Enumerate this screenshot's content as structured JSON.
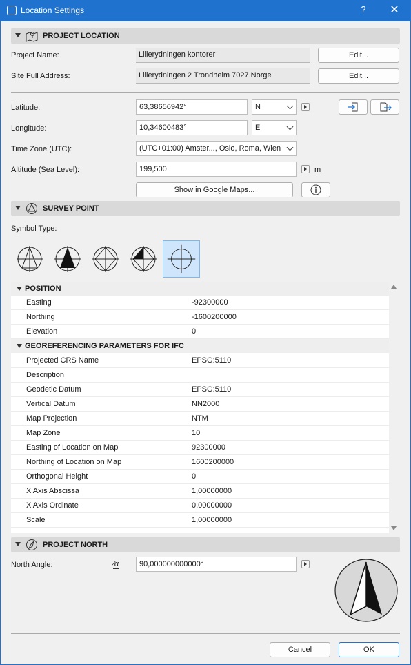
{
  "window": {
    "title": "Location Settings",
    "help": "?",
    "close": "✕"
  },
  "project_location": {
    "header": "PROJECT LOCATION",
    "project_name_label": "Project Name:",
    "project_name": "Lillerydningen kontorer",
    "site_address_label": "Site Full Address:",
    "site_address": "Lillerydningen 2 Trondheim 7027 Norge",
    "edit_label": "Edit...",
    "latitude_label": "Latitude:",
    "latitude": "63,38656942°",
    "lat_dir": "N",
    "longitude_label": "Longitude:",
    "longitude": "10,34600483°",
    "lon_dir": "E",
    "timezone_label": "Time Zone (UTC):",
    "timezone": "(UTC+01:00) Amster..., Oslo, Roma, Wien",
    "altitude_label": "Altitude (Sea Level):",
    "altitude": "199,500",
    "altitude_unit": "m",
    "google_maps_label": "Show in Google Maps..."
  },
  "survey_point": {
    "header": "SURVEY POINT",
    "symbol_type_label": "Symbol Type:",
    "symbols": [
      "symbol-outline-triangle",
      "symbol-filled-triangle",
      "symbol-quadrant-outline",
      "symbol-quadrant-filled",
      "symbol-crosshair"
    ],
    "selected_symbol": 4,
    "position_group": "POSITION",
    "position_rows": [
      {
        "k": "Easting",
        "v": "-92300000"
      },
      {
        "k": "Northing",
        "v": "-1600200000"
      },
      {
        "k": "Elevation",
        "v": "0"
      }
    ],
    "ifc_group": "GEOREFERENCING PARAMETERS FOR IFC",
    "ifc_rows": [
      {
        "k": "Projected CRS Name",
        "v": "EPSG:5110"
      },
      {
        "k": "Description",
        "v": ""
      },
      {
        "k": "Geodetic Datum",
        "v": "EPSG:5110"
      },
      {
        "k": "Vertical Datum",
        "v": "NN2000"
      },
      {
        "k": "Map Projection",
        "v": "NTM"
      },
      {
        "k": "Map Zone",
        "v": "10"
      },
      {
        "k": "Easting of Location on Map",
        "v": "92300000"
      },
      {
        "k": "Northing of Location on Map",
        "v": "1600200000"
      },
      {
        "k": "Orthogonal Height",
        "v": "0"
      },
      {
        "k": "X Axis Abscissa",
        "v": "1,00000000"
      },
      {
        "k": "X Axis Ordinate",
        "v": "0,00000000"
      },
      {
        "k": "Scale",
        "v": "1,00000000"
      }
    ]
  },
  "project_north": {
    "header": "PROJECT NORTH",
    "north_angle_label": "North Angle:",
    "north_angle_icon": "⁄α",
    "north_angle": "90,000000000000°"
  },
  "footer": {
    "cancel": "Cancel",
    "ok": "OK"
  },
  "colors": {
    "accent": "#1f73cf",
    "selected_bg": "#cfe5fb"
  }
}
